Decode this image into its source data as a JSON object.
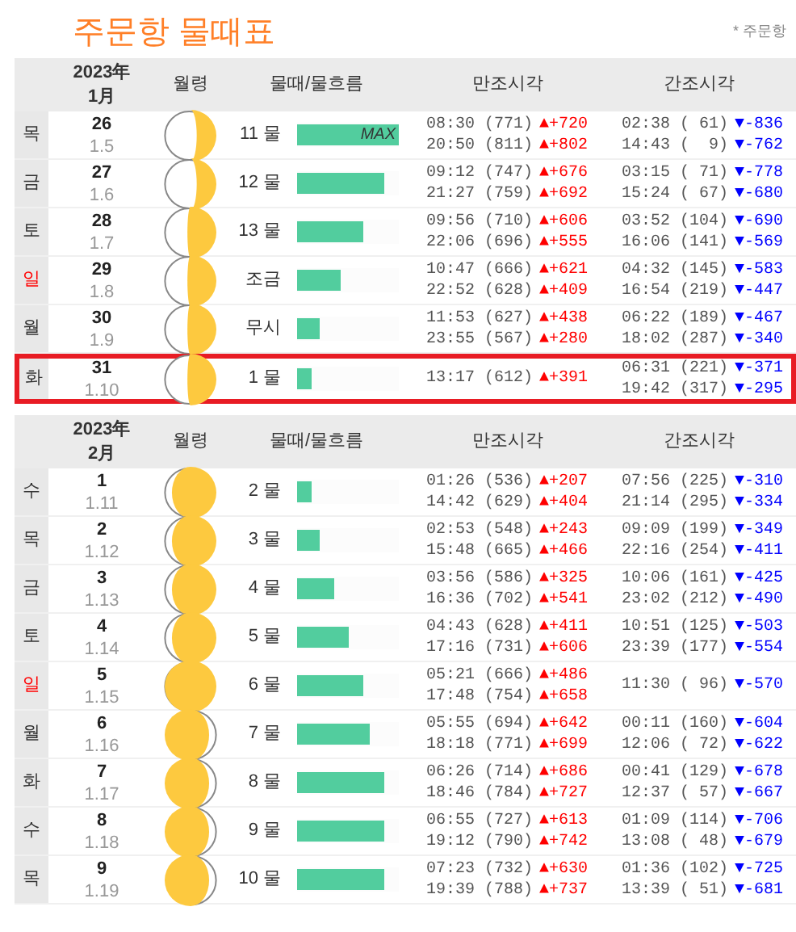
{
  "title": "주문항 물때표",
  "top_link": "* 주문항",
  "months": [
    {
      "header": {
        "year": "2023年",
        "month": "1月",
        "moon": "월령",
        "tide": "물때/물흐름",
        "high": "만조시각",
        "low": "간조시각"
      },
      "rows": [
        {
          "weekday": "목",
          "holiday": false,
          "day": "26",
          "lunar": "1.5",
          "moon": {
            "kind": "crescent",
            "waning": false
          },
          "tide": "11 물",
          "flow": {
            "level": 1.0,
            "label": "MAX"
          },
          "selected": false,
          "high": [
            {
              "time": "08:30 (771)",
              "diff": "▲+720"
            },
            {
              "time": "20:50 (811)",
              "diff": "▲+802"
            }
          ],
          "low": [
            {
              "time": "02:38 ( 61)",
              "diff": "▼-836"
            },
            {
              "time": "14:43 (  9)",
              "diff": "▼-762"
            }
          ]
        },
        {
          "weekday": "금",
          "holiday": false,
          "day": "27",
          "lunar": "1.6",
          "moon": {
            "kind": "crescent",
            "waning": false
          },
          "tide": "12 물",
          "flow": {
            "level": 0.86
          },
          "selected": false,
          "high": [
            {
              "time": "09:12 (747)",
              "diff": "▲+676"
            },
            {
              "time": "21:27 (759)",
              "diff": "▲+692"
            }
          ],
          "low": [
            {
              "time": "03:15 ( 71)",
              "diff": "▼-778"
            },
            {
              "time": "15:24 ( 67)",
              "diff": "▼-680"
            }
          ]
        },
        {
          "weekday": "토",
          "holiday": false,
          "day": "28",
          "lunar": "1.7",
          "moon": {
            "kind": "quarter",
            "waning": false
          },
          "tide": "13 물",
          "flow": {
            "level": 0.65
          },
          "selected": false,
          "high": [
            {
              "time": "09:56 (710)",
              "diff": "▲+606"
            },
            {
              "time": "22:06 (696)",
              "diff": "▲+555"
            }
          ],
          "low": [
            {
              "time": "03:52 (104)",
              "diff": "▼-690"
            },
            {
              "time": "16:06 (141)",
              "diff": "▼-569"
            }
          ]
        },
        {
          "weekday": "일",
          "holiday": true,
          "day": "29",
          "lunar": "1.8",
          "moon": {
            "kind": "quarter",
            "waning": false
          },
          "tide": "조금",
          "flow": {
            "level": 0.43
          },
          "selected": false,
          "high": [
            {
              "time": "10:47 (666)",
              "diff": "▲+621"
            },
            {
              "time": "22:52 (628)",
              "diff": "▲+409"
            }
          ],
          "low": [
            {
              "time": "04:32 (145)",
              "diff": "▼-583"
            },
            {
              "time": "16:54 (219)",
              "diff": "▼-447"
            }
          ]
        },
        {
          "weekday": "월",
          "holiday": false,
          "day": "30",
          "lunar": "1.9",
          "moon": {
            "kind": "quarter",
            "waning": false
          },
          "tide": "무시",
          "flow": {
            "level": 0.22
          },
          "selected": false,
          "high": [
            {
              "time": "11:53 (627)",
              "diff": "▲+438"
            },
            {
              "time": "23:55 (567)",
              "diff": "▲+280"
            }
          ],
          "low": [
            {
              "time": "06:22 (189)",
              "diff": "▼-467"
            },
            {
              "time": "18:02 (287)",
              "diff": "▼-340"
            }
          ]
        },
        {
          "weekday": "화",
          "holiday": false,
          "day": "31",
          "lunar": "1.10",
          "moon": {
            "kind": "quarter",
            "waning": false
          },
          "tide": "1 물",
          "flow": {
            "level": 0.14
          },
          "selected": true,
          "high": [
            {
              "time": "13:17 (612)",
              "diff": "▲+391"
            }
          ],
          "low": [
            {
              "time": "06:31 (221)",
              "diff": "▼-371"
            },
            {
              "time": "19:42 (317)",
              "diff": "▼-295"
            }
          ]
        }
      ]
    },
    {
      "header": {
        "year": "2023年",
        "month": "2月",
        "moon": "월령",
        "tide": "물때/물흐름",
        "high": "만조시각",
        "low": "간조시각"
      },
      "rows": [
        {
          "weekday": "수",
          "holiday": false,
          "day": "1",
          "lunar": "1.11",
          "moon": {
            "kind": "gibbous",
            "waning": false
          },
          "tide": "2 물",
          "flow": {
            "level": 0.14
          },
          "selected": false,
          "high": [
            {
              "time": "01:26 (536)",
              "diff": "▲+207"
            },
            {
              "time": "14:42 (629)",
              "diff": "▲+404"
            }
          ],
          "low": [
            {
              "time": "07:56 (225)",
              "diff": "▼-310"
            },
            {
              "time": "21:14 (295)",
              "diff": "▼-334"
            }
          ]
        },
        {
          "weekday": "목",
          "holiday": false,
          "day": "2",
          "lunar": "1.12",
          "moon": {
            "kind": "gibbous",
            "waning": false
          },
          "tide": "3 물",
          "flow": {
            "level": 0.22
          },
          "selected": false,
          "high": [
            {
              "time": "02:53 (548)",
              "diff": "▲+243"
            },
            {
              "time": "15:48 (665)",
              "diff": "▲+466"
            }
          ],
          "low": [
            {
              "time": "09:09 (199)",
              "diff": "▼-349"
            },
            {
              "time": "22:16 (254)",
              "diff": "▼-411"
            }
          ]
        },
        {
          "weekday": "금",
          "holiday": false,
          "day": "3",
          "lunar": "1.13",
          "moon": {
            "kind": "gibbous",
            "waning": false
          },
          "tide": "4 물",
          "flow": {
            "level": 0.37
          },
          "selected": false,
          "high": [
            {
              "time": "03:56 (586)",
              "diff": "▲+325"
            },
            {
              "time": "16:36 (702)",
              "diff": "▲+541"
            }
          ],
          "low": [
            {
              "time": "10:06 (161)",
              "diff": "▼-425"
            },
            {
              "time": "23:02 (212)",
              "diff": "▼-490"
            }
          ]
        },
        {
          "weekday": "토",
          "holiday": false,
          "day": "4",
          "lunar": "1.14",
          "moon": {
            "kind": "gibbous",
            "waning": false
          },
          "tide": "5 물",
          "flow": {
            "level": 0.51
          },
          "selected": false,
          "high": [
            {
              "time": "04:43 (628)",
              "diff": "▲+411"
            },
            {
              "time": "17:16 (731)",
              "diff": "▲+606"
            }
          ],
          "low": [
            {
              "time": "10:51 (125)",
              "diff": "▼-503"
            },
            {
              "time": "23:39 (177)",
              "diff": "▼-554"
            }
          ]
        },
        {
          "weekday": "일",
          "holiday": true,
          "day": "5",
          "lunar": "1.15",
          "moon": {
            "kind": "full",
            "waning": false
          },
          "tide": "6 물",
          "flow": {
            "level": 0.65
          },
          "selected": false,
          "high": [
            {
              "time": "05:21 (666)",
              "diff": "▲+486"
            },
            {
              "time": "17:48 (754)",
              "diff": "▲+658"
            }
          ],
          "low": [
            {
              "time": "11:30 ( 96)",
              "diff": "▼-570"
            }
          ]
        },
        {
          "weekday": "월",
          "holiday": false,
          "day": "6",
          "lunar": "1.16",
          "moon": {
            "kind": "gibbous",
            "waning": true
          },
          "tide": "7 물",
          "flow": {
            "level": 0.71
          },
          "selected": false,
          "high": [
            {
              "time": "05:55 (694)",
              "diff": "▲+642"
            },
            {
              "time": "18:18 (771)",
              "diff": "▲+699"
            }
          ],
          "low": [
            {
              "time": "00:11 (160)",
              "diff": "▼-604"
            },
            {
              "time": "12:06 ( 72)",
              "diff": "▼-622"
            }
          ]
        },
        {
          "weekday": "화",
          "holiday": false,
          "day": "7",
          "lunar": "1.17",
          "moon": {
            "kind": "gibbous",
            "waning": true
          },
          "tide": "8 물",
          "flow": {
            "level": 0.86
          },
          "selected": false,
          "high": [
            {
              "time": "06:26 (714)",
              "diff": "▲+686"
            },
            {
              "time": "18:46 (784)",
              "diff": "▲+727"
            }
          ],
          "low": [
            {
              "time": "00:41 (129)",
              "diff": "▼-678"
            },
            {
              "time": "12:37 ( 57)",
              "diff": "▼-667"
            }
          ]
        },
        {
          "weekday": "수",
          "holiday": false,
          "day": "8",
          "lunar": "1.18",
          "moon": {
            "kind": "gibbous",
            "waning": true
          },
          "tide": "9 물",
          "flow": {
            "level": 0.86
          },
          "selected": false,
          "high": [
            {
              "time": "06:55 (727)",
              "diff": "▲+613"
            },
            {
              "time": "19:12 (790)",
              "diff": "▲+742"
            }
          ],
          "low": [
            {
              "time": "01:09 (114)",
              "diff": "▼-706"
            },
            {
              "time": "13:08 ( 48)",
              "diff": "▼-679"
            }
          ]
        },
        {
          "weekday": "목",
          "holiday": false,
          "day": "9",
          "lunar": "1.19",
          "moon": {
            "kind": "gibbous",
            "waning": true
          },
          "tide": "10 물",
          "flow": {
            "level": 0.86
          },
          "selected": false,
          "high": [
            {
              "time": "07:23 (732)",
              "diff": "▲+630"
            },
            {
              "time": "19:39 (788)",
              "diff": "▲+737"
            }
          ],
          "low": [
            {
              "time": "01:36 (102)",
              "diff": "▼-725"
            },
            {
              "time": "13:39 ( 51)",
              "diff": "▼-681"
            }
          ]
        }
      ]
    }
  ]
}
